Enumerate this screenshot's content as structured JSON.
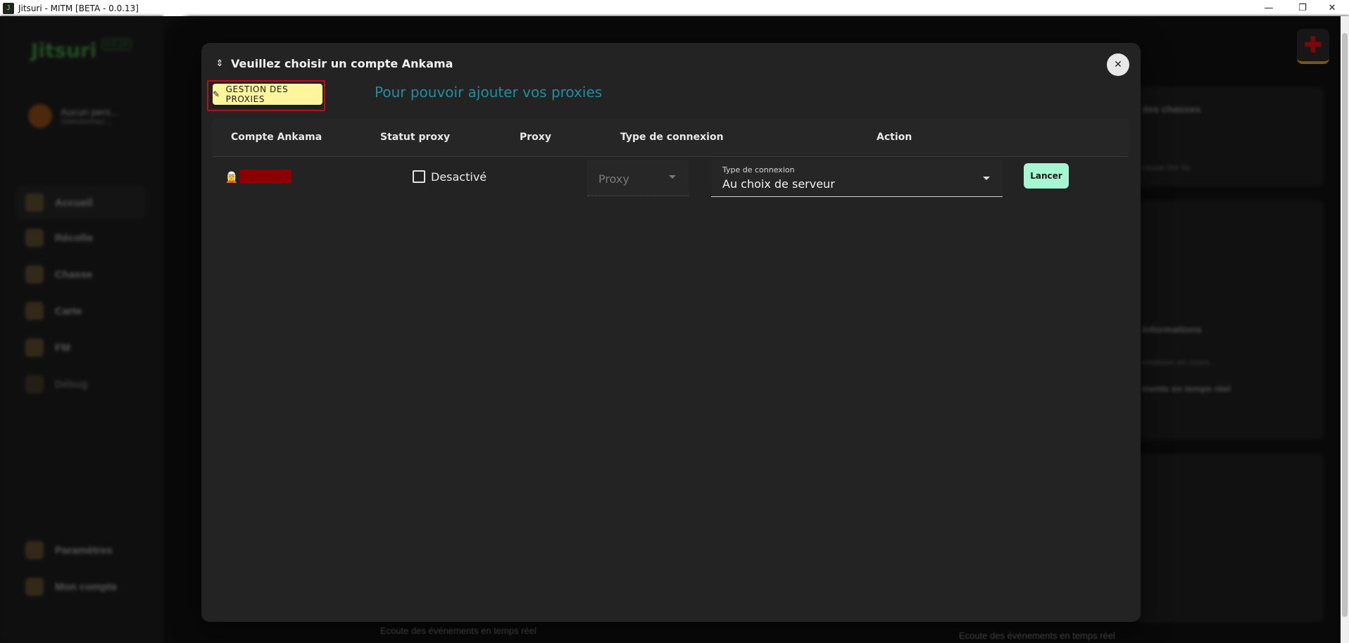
{
  "window": {
    "title": "Jitsuri - MITM [BETA - 0.0.13]",
    "app_icon_glyph": "J",
    "controls": {
      "minimize": "—",
      "maximize": "❐",
      "close": "✕"
    }
  },
  "background": {
    "logo": "Jitsuri",
    "logo_badge": "0.0.13",
    "user": {
      "name": "Aucun pers...",
      "sub": "Sélectionnez..."
    },
    "nav": [
      {
        "label": "Accueil",
        "icon": "home-icon"
      },
      {
        "label": "Récolte",
        "icon": "harvest-icon"
      },
      {
        "label": "Chasse",
        "icon": "hunt-icon"
      },
      {
        "label": "Carte",
        "icon": "map-icon"
      },
      {
        "label": "FM",
        "icon": "fm-icon"
      },
      {
        "label": "Débug",
        "icon": "debug-icon"
      }
    ],
    "nav_bottom": [
      {
        "label": "Paramètres",
        "icon": "settings-icon"
      },
      {
        "label": "Mon compte",
        "icon": "account-icon"
      }
    ],
    "card_texts": {
      "hunts": "des chasses",
      "hunts_sub": "oasse 0m 0s",
      "info": "informations",
      "info_sub": "rmations en cours...",
      "realtime": "ments en temps réel"
    },
    "status_left": "Ecoute des événements en temps réel",
    "status_right": "Ecoute des événements en temps réel",
    "plus_glyph": "✚"
  },
  "modal": {
    "header_icon": "⇕",
    "title": "Veuillez choisir un compte Ankama",
    "close_glyph": "✕",
    "proxy_button": {
      "icon_glyph": "✎",
      "label": "GESTION DES PROXIES"
    },
    "proxy_hint": "Pour pouvoir ajouter vos proxies",
    "table": {
      "headers": {
        "account": "Compte Ankama",
        "proxy_status": "Statut proxy",
        "proxy": "Proxy",
        "connection_type": "Type de connexion",
        "action": "Action"
      },
      "rows": [
        {
          "account_icon": "🧝",
          "account_name": "",
          "proxy_enabled": false,
          "proxy_status_label": "Desactivé",
          "proxy_placeholder": "Proxy",
          "connection_label": "Type de connexion",
          "connection_value": "Au choix de serveur",
          "action_label": "Lancer"
        }
      ]
    }
  }
}
